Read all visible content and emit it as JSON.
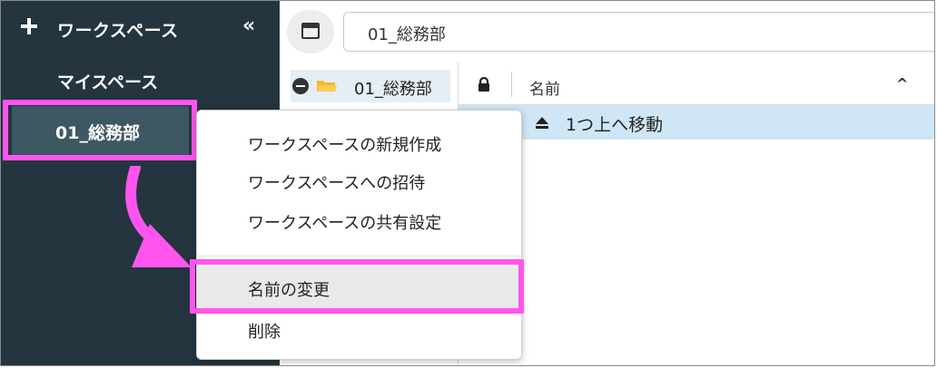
{
  "sidebar": {
    "title": "ワークスペース",
    "collapse_symbol": "«",
    "items": [
      {
        "label": "マイスペース"
      },
      {
        "label": "01_総務部"
      }
    ]
  },
  "toolbar": {
    "path_value": "01_総務部"
  },
  "tree": {
    "folder_label": "01_総務部"
  },
  "list": {
    "header_name": "名前",
    "sort_symbol": "^",
    "rows": [
      {
        "label": "1つ上へ移動"
      }
    ]
  },
  "context_menu": {
    "items": [
      {
        "label": "ワークスペースの新規作成"
      },
      {
        "label": "ワークスペースへの招待"
      },
      {
        "label": "ワークスペースの共有設定"
      },
      {
        "label": "名前の変更"
      },
      {
        "label": "削除"
      }
    ]
  },
  "colors": {
    "sidebar_bg": "#24353f",
    "selected_bg": "#3d5763",
    "highlight": "#ff55ee",
    "row_selected": "#cfe6f6",
    "folder": "#f5b82e"
  },
  "icons": [
    "plus-icon",
    "collapse-icon",
    "window-icon",
    "minus-circle-icon",
    "folder-icon",
    "lock-icon",
    "sort-icon",
    "eject-icon",
    "arrow-icon"
  ]
}
